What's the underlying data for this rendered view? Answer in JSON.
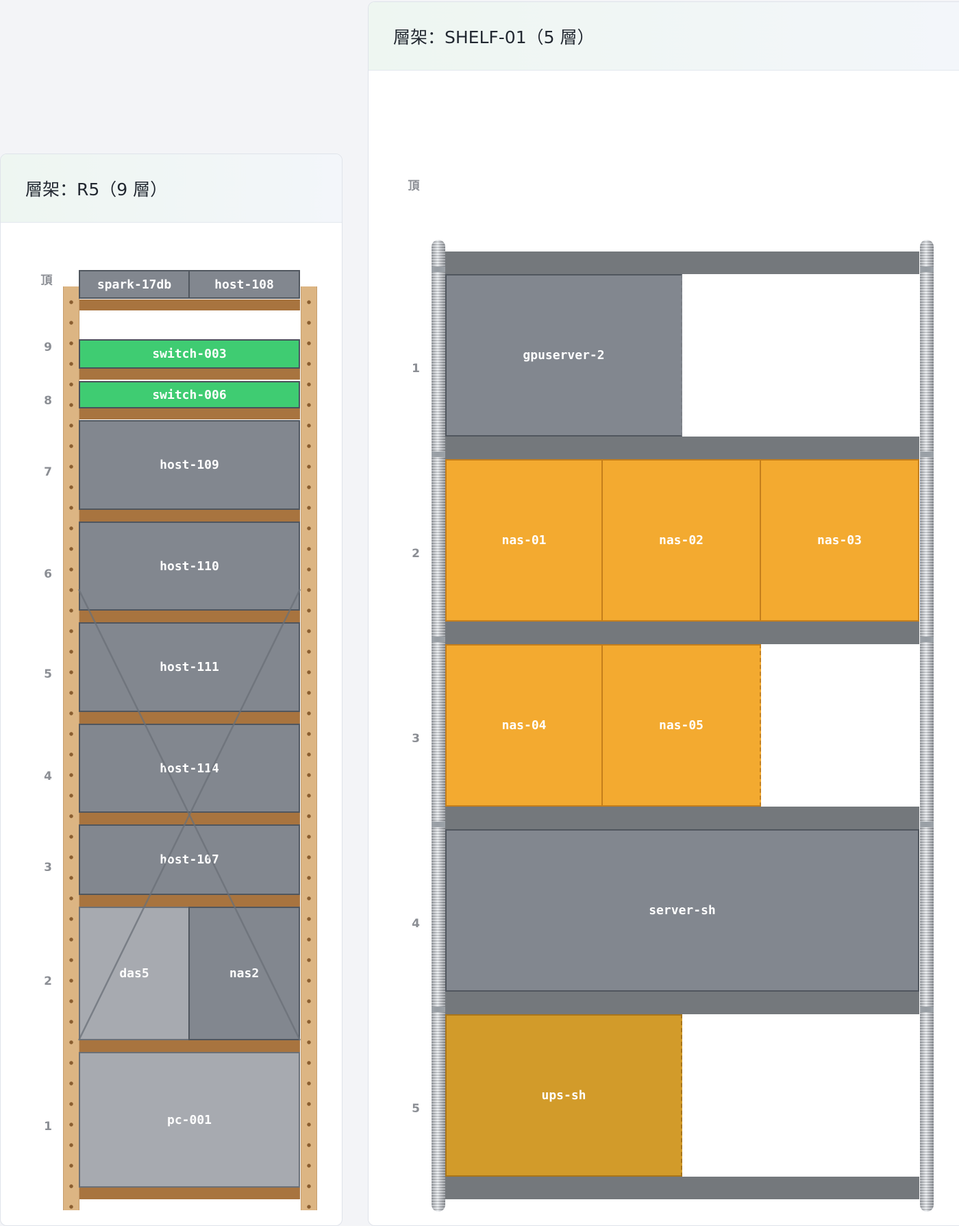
{
  "racks": [
    {
      "title": "層架：R5（9 層）",
      "top_label": "頂",
      "level_labels": [
        "9",
        "8",
        "7",
        "6",
        "5",
        "4",
        "3",
        "2",
        "1"
      ],
      "top_items": [
        "spark-17db",
        "host-108"
      ],
      "items": {
        "l9": "switch-003",
        "l8": "switch-006",
        "l7": "host-109",
        "l6": "host-110",
        "l5": "host-111",
        "l4": "host-114",
        "l3": "host-107",
        "l2a": "das5",
        "l2b": "nas2",
        "l1": "pc-001"
      }
    },
    {
      "title": "層架：SHELF-01（5 層）",
      "top_label": "頂",
      "level_labels": [
        "1",
        "2",
        "3",
        "4",
        "5"
      ],
      "items": {
        "gpuserver": "gpuserver-2",
        "nas01": "nas-01",
        "nas02": "nas-02",
        "nas03": "nas-03",
        "nas04": "nas-04",
        "nas05": "nas-05",
        "server": "server-sh",
        "ups": "ups-sh"
      }
    }
  ],
  "colors": {
    "host": "#82878f",
    "host_light": "#a7aab0",
    "switch": "#3fcc72",
    "nas": "#f3aa30",
    "ups": "#d29b2a",
    "wood": "#a8743f",
    "metal": "#74787c"
  }
}
